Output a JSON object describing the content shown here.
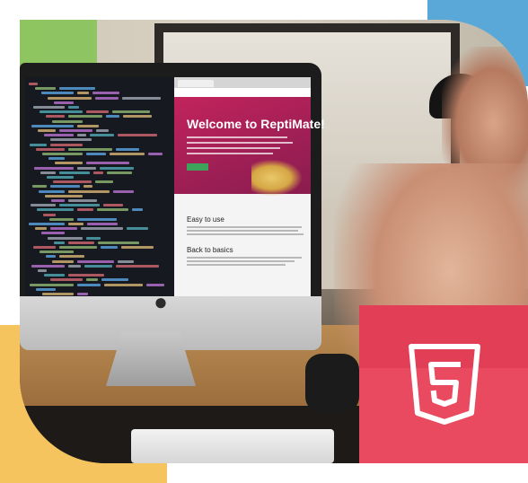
{
  "scene": {
    "description_tags": [
      "monitor-with-code-and-website",
      "hand",
      "desk"
    ]
  },
  "website": {
    "hero_title": "Welcome to ReptiMate!",
    "section_1_title": "Easy to use",
    "section_2_title": "Back to basics"
  },
  "badge": {
    "icon": "html5-icon",
    "color": "#ea4a5f"
  },
  "colors": {
    "yellow_block": "#f6c45f",
    "blue_block": "#5aa8d8",
    "green_block": "#82c452",
    "hero_magenta": "#c2245b"
  }
}
